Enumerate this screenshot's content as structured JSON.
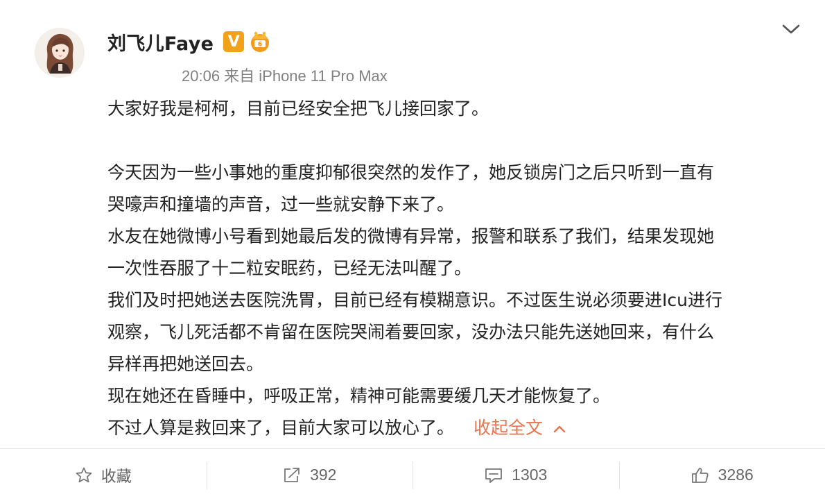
{
  "post": {
    "author": "刘飞儿Faye",
    "verified_badge": "V",
    "meta": "20:06 来自 iPhone 11 Pro Max",
    "lines": [
      "大家好我是柯柯，目前已经安全把飞儿接回家了。",
      "",
      "今天因为一些小事她的重度抑郁很突然的发作了，她反锁房门之后只听到一直有",
      "哭嚎声和撞墙的声音，过一些就安静下来了。",
      "水友在她微博小号看到她最后发的微博有异常，报警和联系了我们，结果发现她",
      "一次性吞服了十二粒安眠药，已经无法叫醒了。",
      "我们及时把她送去医院洗胃，目前已经有模糊意识。不过医生说必须要进Icu进行",
      "观察，飞儿死活都不肯留在医院哭闹着要回家，没办法只能先送她回来，有什么",
      "异样再把她送回去。",
      "现在她还在昏睡中，呼吸正常，精神可能需要缓几天才能恢复了。",
      "不过人算是救回来了，目前大家可以放心了。"
    ],
    "collapse_label": "收起全文"
  },
  "actions": {
    "favorite_label": "收藏",
    "repost_count": "392",
    "comment_count": "1303",
    "like_count": "3286"
  },
  "colors": {
    "link": "#eb7350",
    "badge": "#f1a21a",
    "meta_text": "#808080"
  },
  "icons": [
    "avatar",
    "verified-v-icon",
    "crown-icon",
    "chevron-down-icon",
    "chevron-up-icon",
    "star-icon",
    "share-icon",
    "comment-icon",
    "thumbs-up-icon"
  ]
}
